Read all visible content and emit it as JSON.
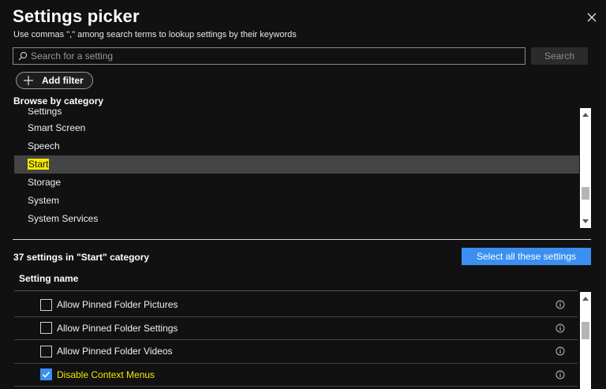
{
  "dialog": {
    "title": "Settings picker",
    "subtitle": "Use commas \",\" among search terms to lookup settings by their keywords"
  },
  "search": {
    "placeholder": "Search for a setting",
    "value": "",
    "button_label": "Search"
  },
  "filter": {
    "add_label": "Add filter"
  },
  "browse": {
    "label": "Browse by category",
    "categories": [
      {
        "label": "Settings"
      },
      {
        "label": "Smart Screen"
      },
      {
        "label": "Speech"
      },
      {
        "label": "Start",
        "selected": true
      },
      {
        "label": "Storage"
      },
      {
        "label": "System"
      },
      {
        "label": "System Services"
      }
    ]
  },
  "results": {
    "count_label": "37 settings in \"Start\" category",
    "select_all_label": "Select all these settings",
    "column_header": "Setting name",
    "settings": [
      {
        "label": "Allow Pinned Folder Pictures",
        "checked": false
      },
      {
        "label": "Allow Pinned Folder Settings",
        "checked": false
      },
      {
        "label": "Allow Pinned Folder Videos",
        "checked": false
      },
      {
        "label": "Disable Context Menus",
        "checked": true
      }
    ]
  },
  "colors": {
    "background": "#111111",
    "accent": "#3a8ff0",
    "highlight": "#f5e800",
    "selected_row": "#444444"
  },
  "icons": {
    "close": "close-icon",
    "search": "search-icon",
    "plus": "plus-icon",
    "info": "info-icon",
    "check": "checkmark-icon"
  }
}
